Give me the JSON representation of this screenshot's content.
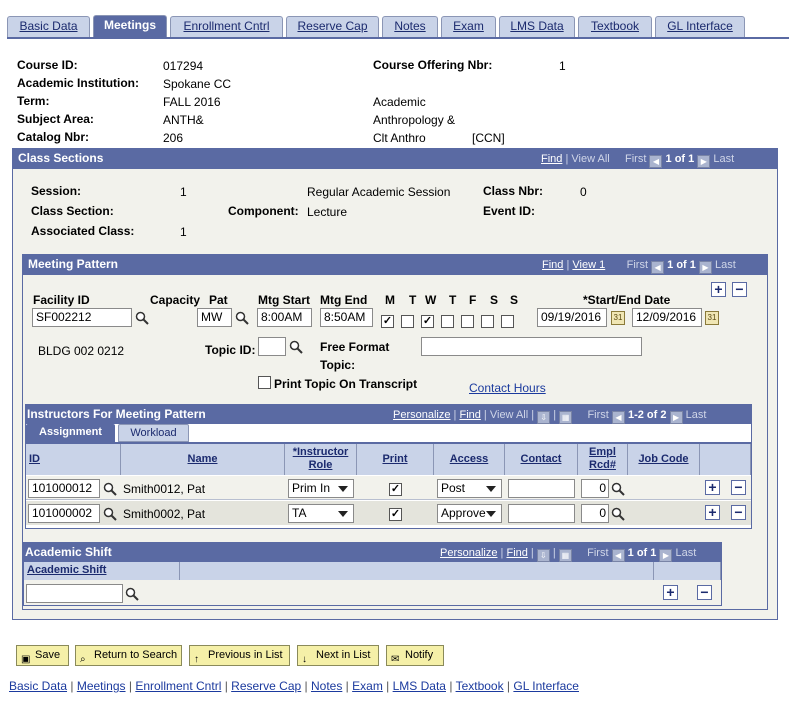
{
  "tabs": [
    "Basic Data",
    "Meetings",
    "Enrollment Cntrl",
    "Reserve Cap",
    "Notes",
    "Exam",
    "LMS Data",
    "Textbook",
    "GL Interface"
  ],
  "header": {
    "course_id_label": "Course ID:",
    "course_id": "017294",
    "institution_label": "Academic Institution:",
    "institution": "Spokane CC",
    "term_label": "Term:",
    "term": "FALL 2016",
    "subject_label": "Subject Area:",
    "subject": "ANTH&",
    "catalog_label": "Catalog Nbr:",
    "catalog": "206",
    "offering_label": "Course Offering Nbr:",
    "offering": "1",
    "org_line1": "Academic",
    "org_line2": "Anthropology &",
    "org_line3": "Clt Anthro",
    "ccn": "[CCN]"
  },
  "class_sections": {
    "title": "Class Sections",
    "find": "Find",
    "view_all": "View All",
    "first": "First",
    "count": "1 of 1",
    "last": "Last",
    "session_label": "Session:",
    "session": "1",
    "session_name": "Regular Academic Session",
    "class_nbr_label": "Class Nbr:",
    "class_nbr": "0",
    "section_label": "Class Section:",
    "component_label": "Component:",
    "component": "Lecture",
    "event_label": "Event ID:",
    "assoc_label": "Associated Class:",
    "assoc": "1"
  },
  "meeting_pattern": {
    "title": "Meeting Pattern",
    "find": "Find",
    "view": "View 1",
    "first": "First",
    "count": "1 of 1",
    "last": "Last",
    "facility_label": "Facility ID",
    "capacity_label": "Capacity",
    "pat_label": "Pat",
    "mtg_start_label": "Mtg Start",
    "mtg_end_label": "Mtg End",
    "days": [
      "M",
      "T",
      "W",
      "T",
      "F",
      "S",
      "S"
    ],
    "days_checked": [
      true,
      false,
      true,
      false,
      false,
      false,
      false
    ],
    "date_label": "*Start/End Date",
    "facility": "SF002212",
    "pat": "MW",
    "mtg_start": "8:00AM",
    "mtg_end": "8:50AM",
    "start_date": "09/19/2016",
    "end_date": "12/09/2016",
    "bldg": "BLDG 002  0212",
    "topic_label": "Topic ID:",
    "free_topic_label1": "Free Format",
    "free_topic_label2": "Topic:",
    "print_topic": "Print Topic On Transcript",
    "contact_hours": "Contact Hours"
  },
  "instructors": {
    "title": "Instructors For Meeting Pattern",
    "personalize": "Personalize",
    "find": "Find",
    "view_all": "View All",
    "first": "First",
    "count": "1-2 of 2",
    "last": "Last",
    "subtabs": [
      "Assignment",
      "Workload"
    ],
    "columns": [
      "ID",
      "Name",
      "*Instructor Role",
      "Print",
      "Access",
      "Contact",
      "Empl Rcd#",
      "Job Code"
    ],
    "rows": [
      {
        "id": "101000012",
        "name": "Smith0012, Pat",
        "role": "Prim In",
        "print": true,
        "access": "Post",
        "contact": "",
        "empl": "0"
      },
      {
        "id": "101000002",
        "name": "Smith0002, Pat",
        "role": "TA",
        "print": true,
        "access": "Approve",
        "contact": "",
        "empl": "0"
      }
    ]
  },
  "academic_shift": {
    "title": "Academic Shift",
    "personalize": "Personalize",
    "find": "Find",
    "first": "First",
    "count": "1 of 1",
    "last": "Last",
    "column": "Academic Shift",
    "value": ""
  },
  "buttons": [
    "Save",
    "Return to Search",
    "Previous in List",
    "Next in List",
    "Notify"
  ],
  "footer_links": [
    "Basic Data",
    "Meetings",
    "Enrollment Cntrl",
    "Reserve Cap",
    "Notes",
    "Exam",
    "LMS Data",
    "Textbook",
    "GL Interface"
  ],
  "colors": {
    "header": "#5a6aa3",
    "tab": "#c9d3e8",
    "panel": "#f2f2ec",
    "button": "#f5f0a8"
  }
}
